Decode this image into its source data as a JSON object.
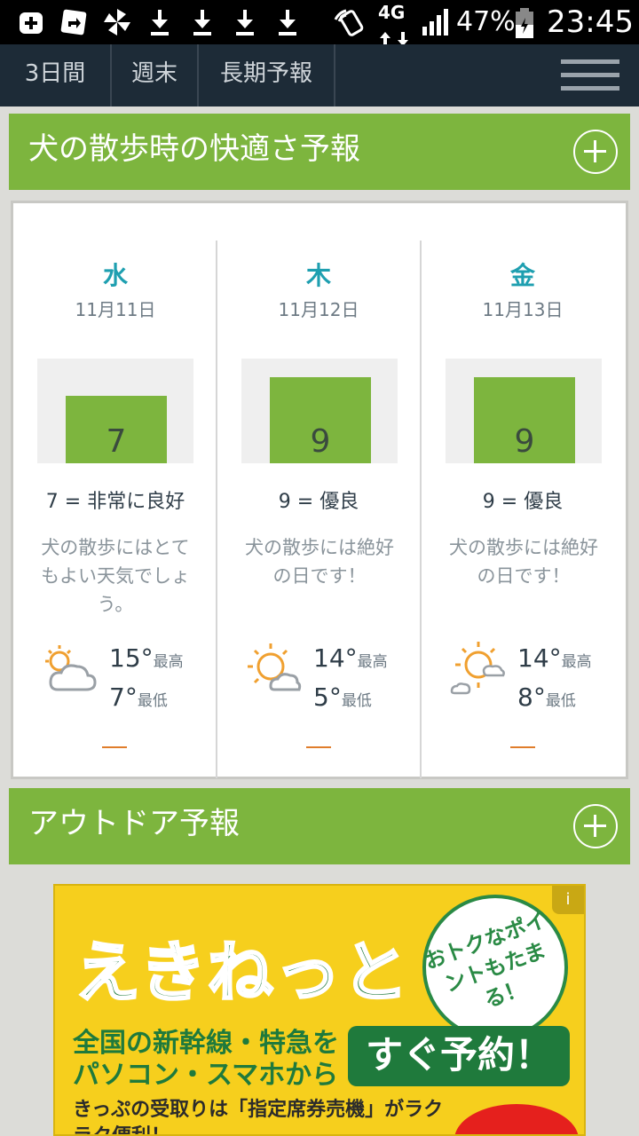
{
  "status_bar": {
    "icons": [
      "plus-box-icon",
      "navigation-icon",
      "pinwheel-icon",
      "download-icon",
      "download-icon",
      "download-icon",
      "download-icon",
      "nfc-icon",
      "4g-icon",
      "signal-icon",
      "battery-icon"
    ],
    "network": "4G",
    "battery": "47%",
    "time": "23:45"
  },
  "nav": {
    "tabs": [
      "3日間",
      "週末",
      "長期予報"
    ]
  },
  "section1": {
    "title": "犬の散歩時の快適さ予報"
  },
  "days": [
    {
      "dow": "水",
      "date": "11月11日",
      "score": 7,
      "rating": "7 = 非常に良好",
      "desc": "犬の散歩にはとてもよい天気でしょう。",
      "icon": "partly-cloudy-icon",
      "tmax": "15°",
      "tmin": "7°",
      "max_label": "最高",
      "min_label": "最低",
      "dash": "—"
    },
    {
      "dow": "木",
      "date": "11月12日",
      "score": 9,
      "rating": "9 = 優良",
      "desc": "犬の散歩には絶好の日です！",
      "icon": "sun-cloud-icon",
      "tmax": "14°",
      "tmin": "5°",
      "max_label": "最高",
      "min_label": "最低",
      "dash": "—"
    },
    {
      "dow": "金",
      "date": "11月13日",
      "score": 9,
      "rating": "9 = 優良",
      "desc": "犬の散歩には絶好の日です！",
      "icon": "sun-small-clouds-icon",
      "tmax": "14°",
      "tmin": "8°",
      "max_label": "最高",
      "min_label": "最低",
      "dash": "—"
    }
  ],
  "section2": {
    "title": "アウトドア予報"
  },
  "ad": {
    "info": "i",
    "headline": "えきねっと",
    "badge": "おトクなポイントもたまる！",
    "line1": "全国の新幹線・特急をパソコン・スマホから",
    "cta": "すぐ予約！",
    "line2": "きっぷの受取りは「指定席券売機」がラクラク便利！"
  }
}
